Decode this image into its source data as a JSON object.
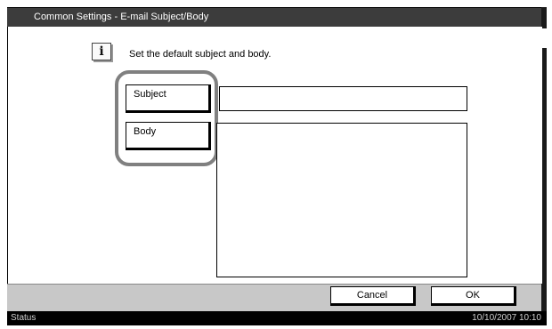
{
  "window": {
    "title": "Common Settings - E-mail Subject/Body"
  },
  "info": {
    "icon": "info-icon",
    "glyph": "i",
    "message": "Set the default subject and body."
  },
  "form": {
    "subject_label": "Subject",
    "subject_value": "",
    "body_label": "Body",
    "body_value": ""
  },
  "buttons": {
    "cancel": "Cancel",
    "ok": "OK"
  },
  "statusbar": {
    "status": "Status",
    "datetime": "10/10/2007   10:10"
  },
  "colors": {
    "titlebar": "#3c3c3c",
    "bottombar": "#c8c8c8",
    "statusbar": "#000000",
    "highlight": "#808080"
  }
}
